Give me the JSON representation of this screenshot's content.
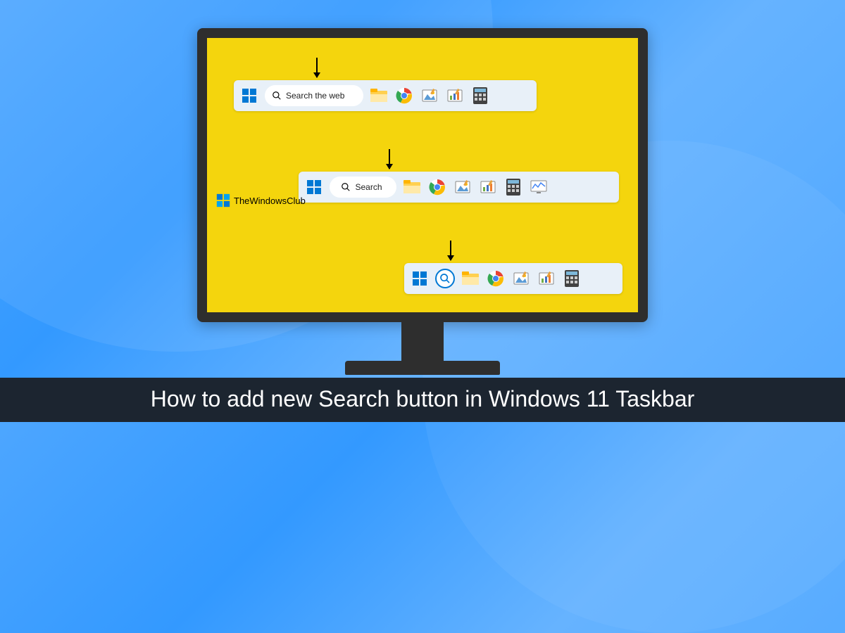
{
  "title": "How to add new Search button in Windows 11 Taskbar",
  "watermark": "TheWindowsClub",
  "taskbar1": {
    "search_label": "Search the web",
    "icons": [
      "start",
      "search-pill-wide",
      "file-explorer",
      "chrome",
      "paint",
      "chart-app",
      "calculator"
    ]
  },
  "taskbar2": {
    "search_label": "Search",
    "icons": [
      "start",
      "search-pill-narrow",
      "file-explorer",
      "chrome",
      "paint",
      "chart-app",
      "calculator",
      "monitor-app"
    ]
  },
  "taskbar3": {
    "icons": [
      "start",
      "search-icon-only",
      "file-explorer",
      "chrome",
      "paint",
      "chart-app",
      "calculator"
    ]
  },
  "colors": {
    "screen_bg": "#f4d50d",
    "taskbar_bg": "#e8f0f8",
    "title_bg": "#1c2530",
    "accent": "#0078d4"
  }
}
